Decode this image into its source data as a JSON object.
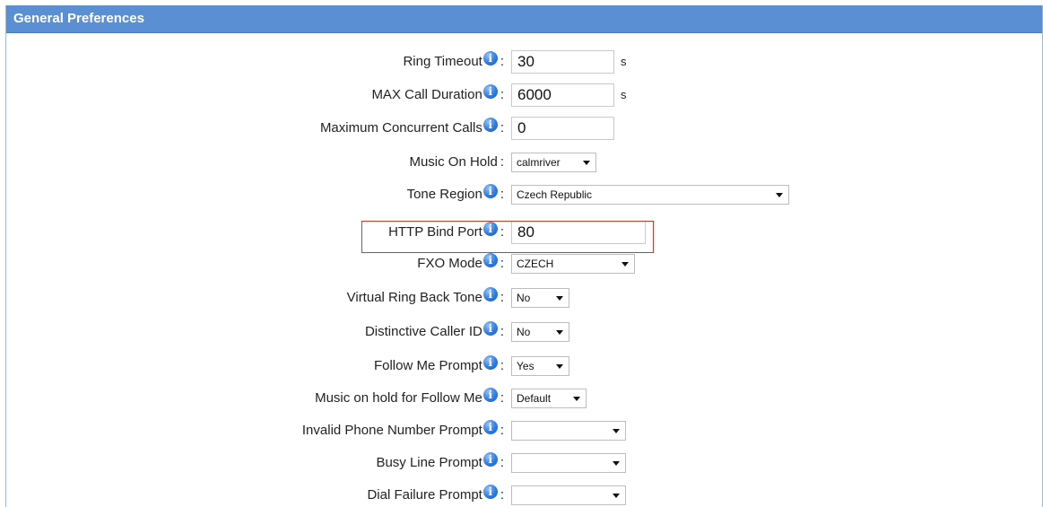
{
  "panel": {
    "title": "General Preferences"
  },
  "settings": [
    {
      "label": "Ring Timeout",
      "type": "text",
      "value": "30",
      "unit": "s",
      "info": true
    },
    {
      "label": "MAX Call Duration",
      "type": "text",
      "value": "6000",
      "unit": "s",
      "info": true
    },
    {
      "label": "Maximum Concurrent Calls",
      "type": "text",
      "value": "0",
      "unit": "",
      "info": true
    },
    {
      "label": "Music On Hold",
      "type": "select",
      "value": "calmriver",
      "info": false
    },
    {
      "label": "Tone Region",
      "type": "select",
      "value": "Czech Republic",
      "info": true
    },
    {
      "label": "HTTP Bind Port",
      "type": "text",
      "value": "80",
      "unit": "",
      "info": true,
      "highlighted": true
    },
    {
      "label": "FXO Mode",
      "type": "select",
      "value": "CZECH",
      "info": true
    },
    {
      "label": "Virtual Ring Back Tone",
      "type": "select",
      "value": "No",
      "info": true
    },
    {
      "label": "Distinctive Caller ID",
      "type": "select",
      "value": "No",
      "info": true
    },
    {
      "label": "Follow Me Prompt",
      "type": "select",
      "value": "Yes",
      "info": true
    },
    {
      "label": "Music on hold for Follow Me",
      "type": "select",
      "value": "Default",
      "info": true
    },
    {
      "label": "Invalid Phone Number Prompt",
      "type": "select",
      "value": "",
      "info": true
    },
    {
      "label": "Busy Line Prompt",
      "type": "select",
      "value": "",
      "info": true
    },
    {
      "label": "Dial Failure Prompt",
      "type": "select",
      "value": "",
      "info": true
    }
  ],
  "colors": {
    "header": "#5b8fd3",
    "highlight": "#e0302e",
    "info_icon": "#2f7bdc"
  },
  "icons": {
    "info": "info-icon"
  }
}
